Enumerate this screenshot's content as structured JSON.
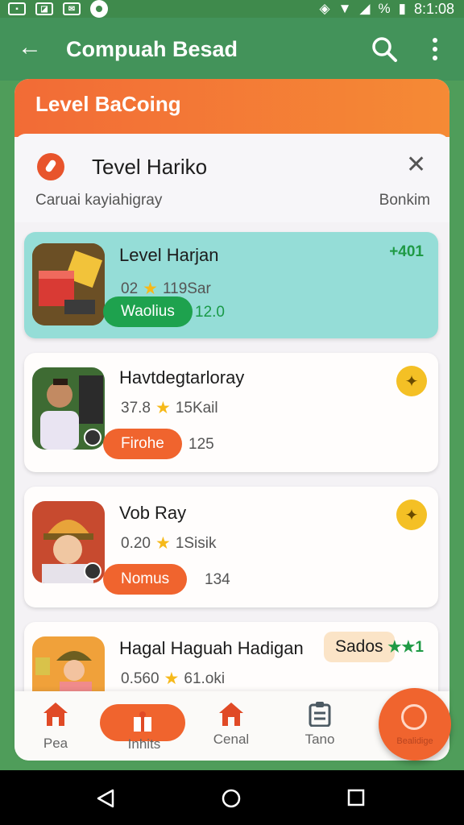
{
  "status_bar": {
    "time": "8:1:08",
    "battery_label": "%"
  },
  "app_bar": {
    "title": "Compuah Besad"
  },
  "sheet": {
    "header_title": "Level BaCoing",
    "subheader": {
      "name": "Tevel Hariko",
      "caption": "Caruai  kayiahigray",
      "right_label": "Bonkim"
    }
  },
  "cards": [
    {
      "title": "Level Harjan",
      "meta_left": "02",
      "meta_right": "119Sar",
      "pill": "Waolius",
      "num": "12.0",
      "tag": "+401"
    },
    {
      "title": "Havtdegtarloray",
      "meta_left": "37.8",
      "meta_right": "15Kail",
      "pill": "Firohe",
      "num": "125"
    },
    {
      "title": "Vob Ray",
      "meta_left": "0.20",
      "meta_right": "1Sisik",
      "pill": "Nomus",
      "num": "134"
    },
    {
      "title": "Hagal Haguah Hadigan",
      "meta_left": "0.560",
      "meta_right": "61.oki",
      "chip": "Sados",
      "tag": "★★1"
    }
  ],
  "bottom_nav": {
    "items": [
      {
        "label": "Pea"
      },
      {
        "label": "Inhits"
      },
      {
        "label": "Cenal"
      },
      {
        "label": "Tano"
      }
    ],
    "fab_label": "Bealidige"
  },
  "colors": {
    "primary_green": "#43935a",
    "accent_orange": "#f0642e",
    "active_card": "#95ddd7"
  }
}
